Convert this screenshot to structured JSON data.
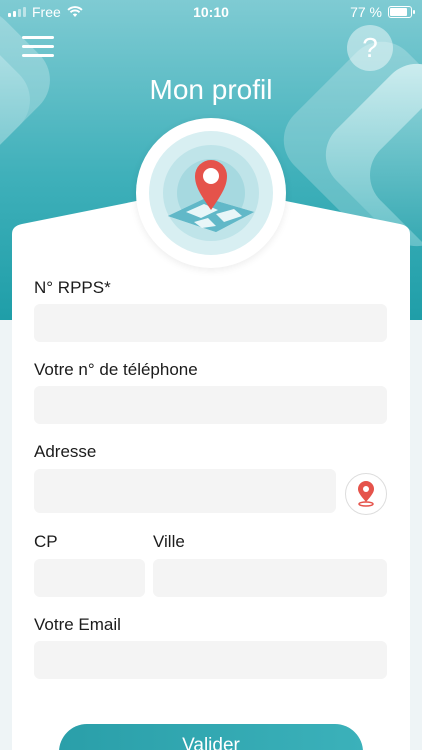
{
  "status_bar": {
    "carrier": "Free",
    "time": "10:10",
    "battery": "77 %",
    "battery_level": 0.77
  },
  "header": {
    "title": "Mon profil",
    "help_label": "?"
  },
  "form": {
    "rpps_label": "N° RPPS*",
    "phone_label": "Votre n° de téléphone",
    "address_label": "Adresse",
    "cp_label": "CP",
    "city_label": "Ville",
    "email_label": "Votre Email",
    "submit_label": "Valider"
  },
  "colors": {
    "accent": "#2a9fa9",
    "pin": "#e5534b"
  },
  "icons": [
    "menu-icon",
    "help-icon",
    "map-pin-icon",
    "location-pin-icon",
    "wifi-icon",
    "battery-icon",
    "signal-icon"
  ]
}
